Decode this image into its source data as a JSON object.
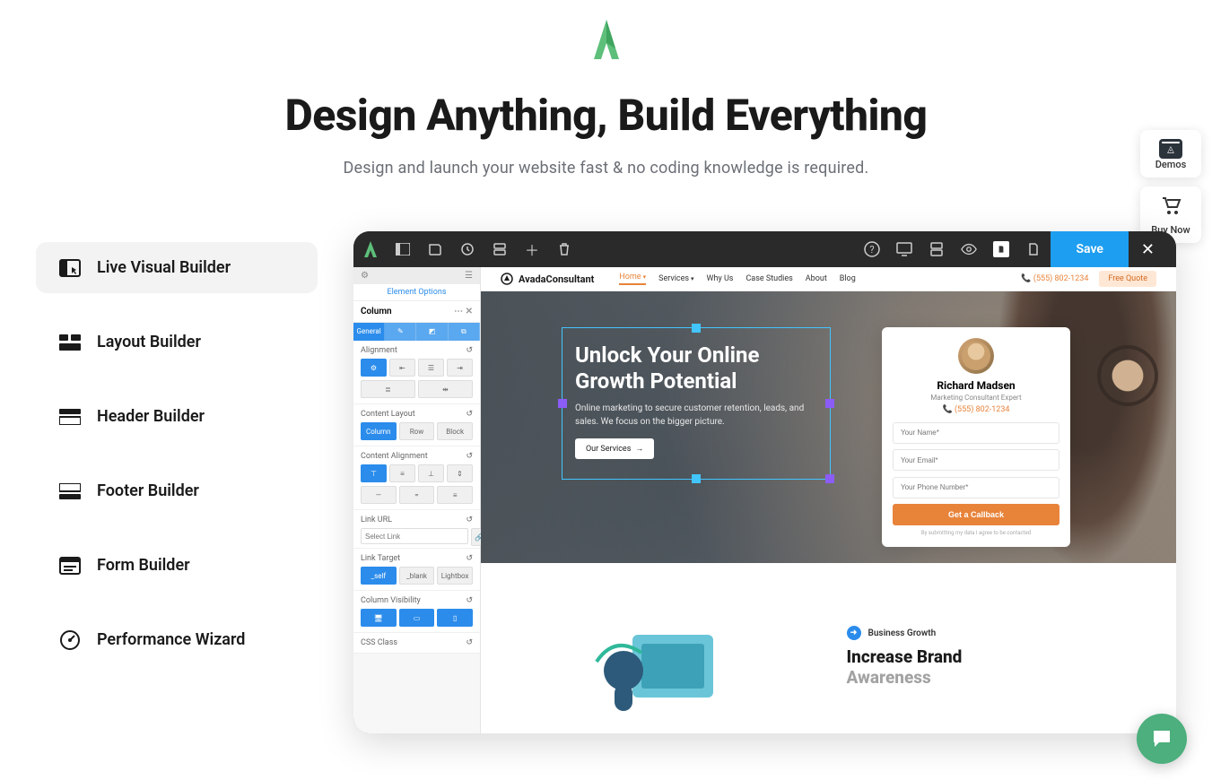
{
  "hero": {
    "title": "Design Anything, Build Everything",
    "subtitle": "Design and launch your website fast & no coding knowledge is required."
  },
  "floatButtons": {
    "demos": "Demos",
    "buy": "Buy Now"
  },
  "tabs": [
    {
      "label": "Live Visual Builder",
      "icon": "cursor-window"
    },
    {
      "label": "Layout Builder",
      "icon": "grid"
    },
    {
      "label": "Header Builder",
      "icon": "header-bar"
    },
    {
      "label": "Footer Builder",
      "icon": "footer-bar"
    },
    {
      "label": "Form Builder",
      "icon": "form"
    },
    {
      "label": "Performance Wizard",
      "icon": "gauge"
    }
  ],
  "topbar": {
    "save": "Save"
  },
  "panel": {
    "headerTitle": "Element Options",
    "section": "Column",
    "tabGeneral": "General",
    "groups": {
      "alignment": "Alignment",
      "contentLayout": "Content Layout",
      "contentAlignment": "Content Alignment",
      "linkUrl": "Link URL",
      "linkTarget": "Link Target",
      "columnVisibility": "Column Visibility",
      "cssClass": "CSS Class"
    },
    "buttons": {
      "column": "Column",
      "row": "Row",
      "block": "Block",
      "self": "_self",
      "blank": "_blank",
      "lightbox": "Lightbox"
    },
    "placeholders": {
      "selectLink": "Select Link"
    }
  },
  "site": {
    "brand": "AvadaConsultant",
    "nav": [
      "Home",
      "Services",
      "Why Us",
      "Case Studies",
      "About",
      "Blog"
    ],
    "phone": "(555) 802-1234",
    "quote": "Free Quote",
    "heroTitle": "Unlock Your Online Growth Potential",
    "heroText": "Online marketing to secure customer retention, leads, and sales. We focus on the bigger picture.",
    "heroBtn": "Our Services",
    "card": {
      "name": "Richard Madsen",
      "role": "Marketing Consultant Expert",
      "phone": "(555) 802-1234",
      "p1": "Your Name*",
      "p2": "Your Email*",
      "p3": "Your Phone Number*",
      "submit": "Get a Callback",
      "note": "By submitting my data I agree to be contacted"
    },
    "growth": {
      "badge": "Business Growth",
      "title1": "Increase Brand",
      "title2": "Awareness"
    }
  }
}
